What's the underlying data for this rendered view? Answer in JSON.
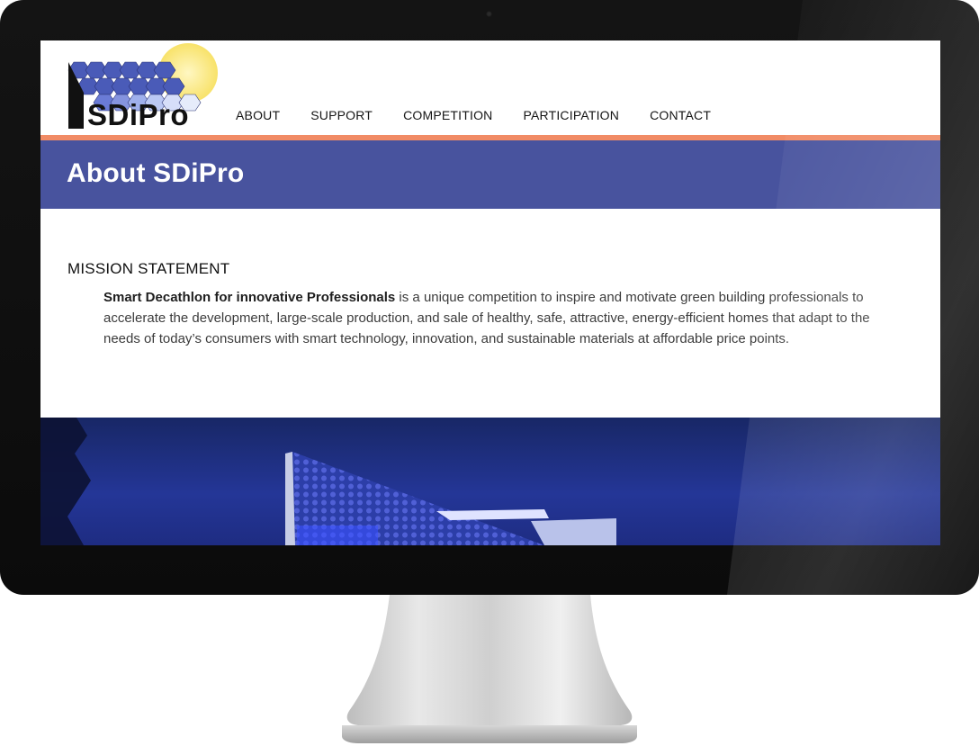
{
  "site": {
    "logo_text": "SDiPro"
  },
  "nav": {
    "items": [
      {
        "label": "ABOUT"
      },
      {
        "label": "SUPPORT"
      },
      {
        "label": "COMPETITION"
      },
      {
        "label": "PARTICIPATION"
      },
      {
        "label": "CONTACT"
      }
    ]
  },
  "banner": {
    "title": "About SDiPro"
  },
  "mission": {
    "heading": "MISSION STATEMENT",
    "lead": "Smart Decathlon for innovative Professionals",
    "body": " is a unique competition to inspire and motivate green building professionals to accelerate the development, large-scale production, and sale of healthy, safe, attractive, energy-efficient homes that adapt to the needs of today’s consumers with smart technology, innovation, and sustainable materials at affordable price points."
  },
  "colors": {
    "accent_orange": "#f18b65",
    "banner_blue": "#48539e",
    "hero_blue": "#21308a"
  },
  "icons": {
    "logo": "solar-panel-sun-logo"
  }
}
